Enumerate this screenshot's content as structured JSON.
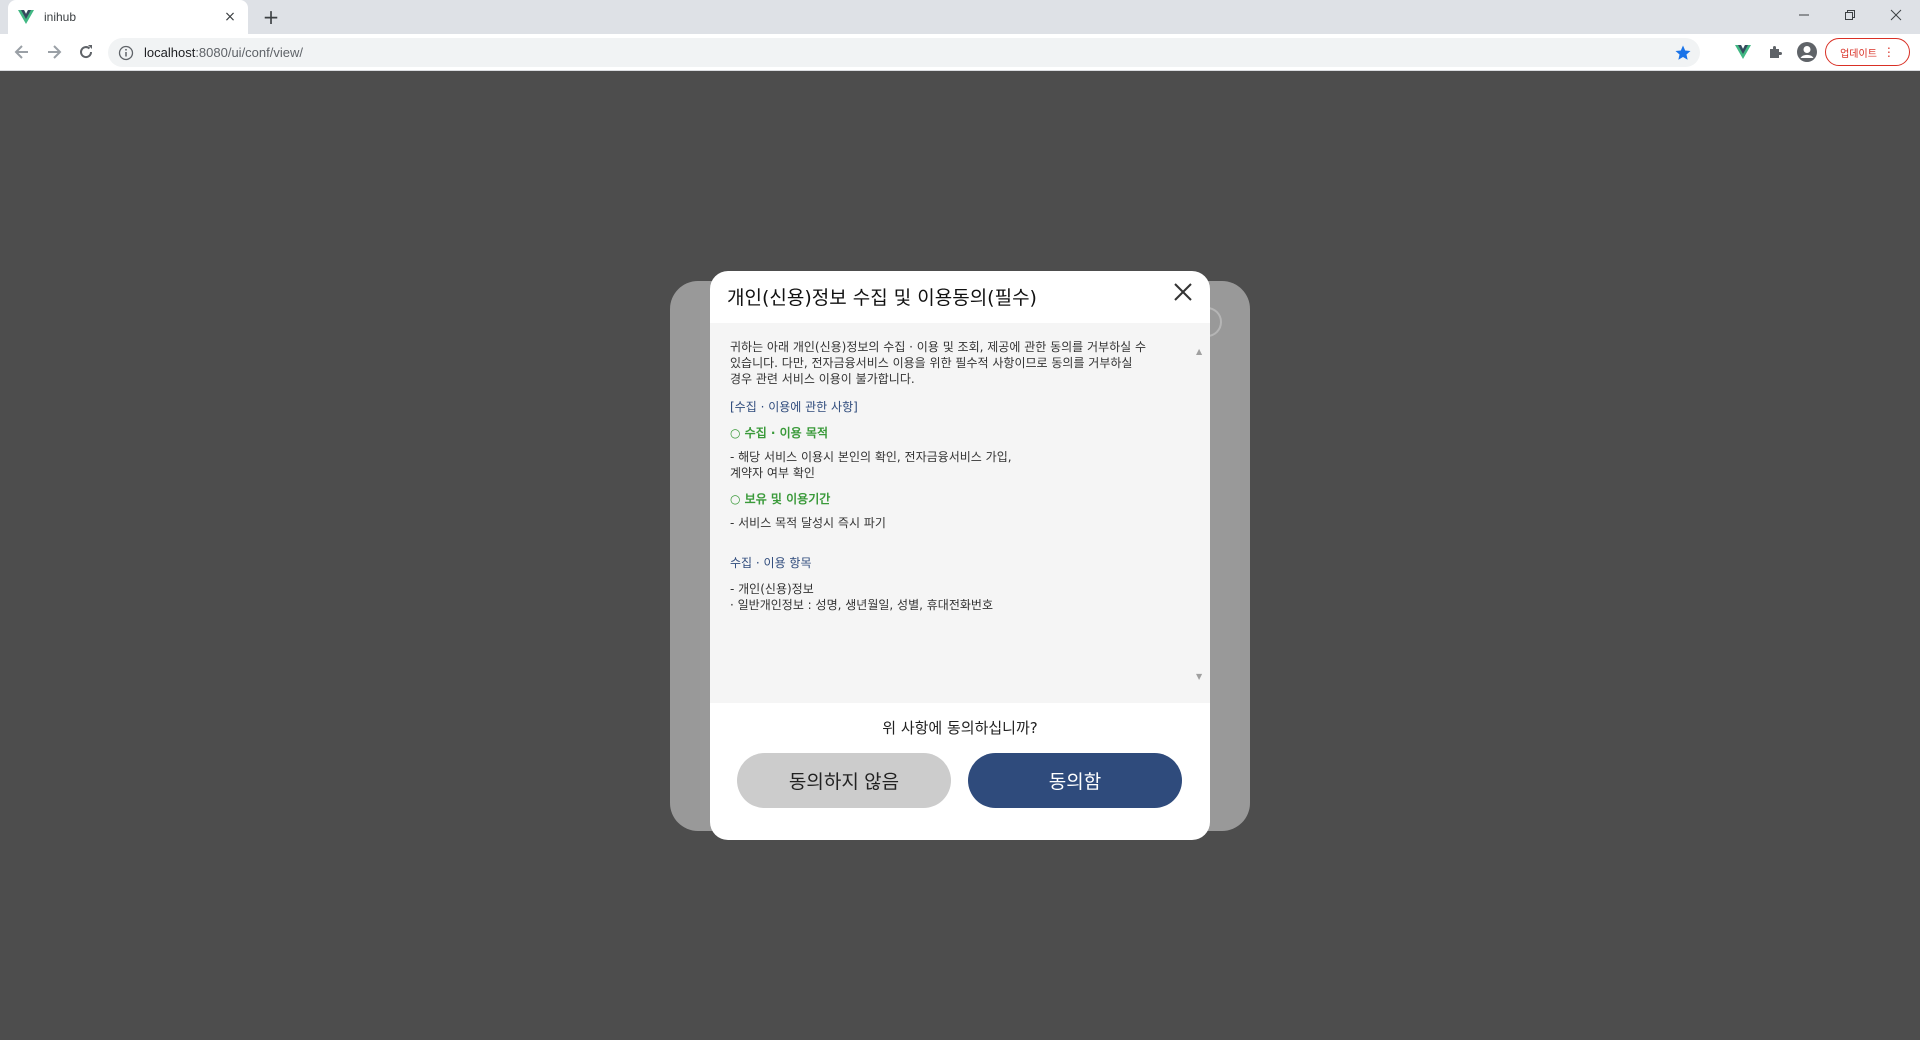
{
  "browser": {
    "tab_title": "inihub",
    "tab_close": "×",
    "new_tab": "+",
    "url_host": "localhost",
    "url_path": ":8080/ui/conf/view/",
    "update_label": "업데이트",
    "update_menu": "⋮",
    "accent": "#1a73e8",
    "update_color": "#d93025"
  },
  "modal": {
    "title": "개인(신용)정보 수집 및 이용동의(필수)",
    "intro_1": "귀하는 아래 개인(신용)정보의 수집 · 이용 및 조회, 제공에 관한 동의를 거부하실 수",
    "intro_2": "있습니다. 다만, 전자금융서비스 이용을 위한 필수적 사항이므로 동의를 거부하실",
    "intro_3": "경우 관련 서비스 이용이 불가합니다.",
    "section_collect": "[수집 · 이용에 관한 사항]",
    "purpose_heading": "○ 수집 · 이용 목적",
    "purpose_1": "- 해당 서비스 이용시 본인의 확인, 전자금융서비스 가입,",
    "purpose_2": "계약자 여부 확인",
    "retention_heading": "○ 보유 및 이용기간",
    "retention_1": "- 서비스 목적 달성시 즉시 파기",
    "items_heading": "수집 · 이용 항목",
    "items_1": "- 개인(신용)정보",
    "items_2": "· 일반개인정보 : 성명, 생년월일, 성별, 휴대전화번호",
    "question": "위 사항에 동의하십니까?",
    "decline_label": "동의하지 않음",
    "agree_label": "동의함",
    "primary_color": "#2f4b7c",
    "highlight_color": "#3a9a3a"
  }
}
